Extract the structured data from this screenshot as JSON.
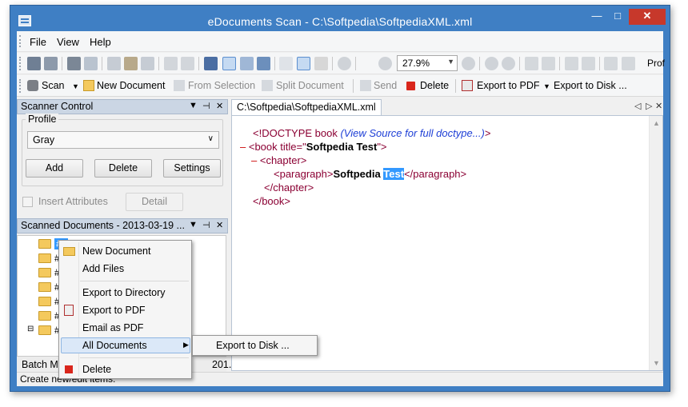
{
  "window": {
    "title": "eDocuments Scan - C:\\Softpedia\\SoftpediaXML.xml",
    "minimize": "—",
    "maximize": "□",
    "close": "✕"
  },
  "menu": {
    "file": "File",
    "view": "View",
    "help": "Help"
  },
  "toolbar1": {
    "zoom_value": "27.9%",
    "overflow_text": "Prof"
  },
  "toolbar2": {
    "scan": "Scan",
    "new_document": "New Document",
    "from_selection": "From Selection",
    "split_document": "Split Document",
    "send": "Send",
    "delete": "Delete",
    "export_to_pdf": "Export to PDF",
    "export_to_disk": "Export to Disk ..."
  },
  "scanner_control": {
    "header": "Scanner Control",
    "profile_label": "Profile",
    "profile_value": "Gray",
    "add_button": "Add",
    "delete_button": "Delete",
    "settings_button": "Settings",
    "insert_attributes": "Insert Attributes",
    "detail_button": "Detail"
  },
  "scanned_documents": {
    "header": "Scanned Documents - 2013-03-19 ...",
    "items": [
      "#1",
      "#",
      "#",
      "#",
      "#",
      "#",
      "#"
    ],
    "tabs": [
      "Batch M",
      "201..."
    ]
  },
  "status": {
    "text": "Create new/edit items."
  },
  "document_tab": {
    "title": "C:\\Softpedia\\SoftpediaXML.xml"
  },
  "xml": {
    "doctype_tag": "<!DOCTYPE book ",
    "doctype_comment": "(View Source for full doctype...)",
    "doctype_close": ">",
    "minus": "–",
    "book_open_prefix": "<book title=\"",
    "book_title_value": "Softpedia Test",
    "book_open_suffix": "\">",
    "chapter_open": "<chapter>",
    "paragraph_open": "<paragraph>",
    "paragraph_text_a": "Softpedia ",
    "paragraph_text_b": "Test",
    "paragraph_close": "</paragraph>",
    "chapter_close": "</chapter>",
    "book_close": "</book>"
  },
  "context_menu": {
    "new_document": "New Document",
    "add_files": "Add Files",
    "export_to_directory": "Export to Directory",
    "export_to_pdf": "Export to PDF",
    "email_as_pdf": "Email as PDF",
    "all_documents": "All Documents",
    "delete": "Delete"
  },
  "submenu": {
    "export_to_disk": "Export to Disk ..."
  },
  "colors": {
    "title_bar": "#3f7fc4",
    "selection": "#3399ff",
    "panel_header": "#cbd6e4"
  }
}
